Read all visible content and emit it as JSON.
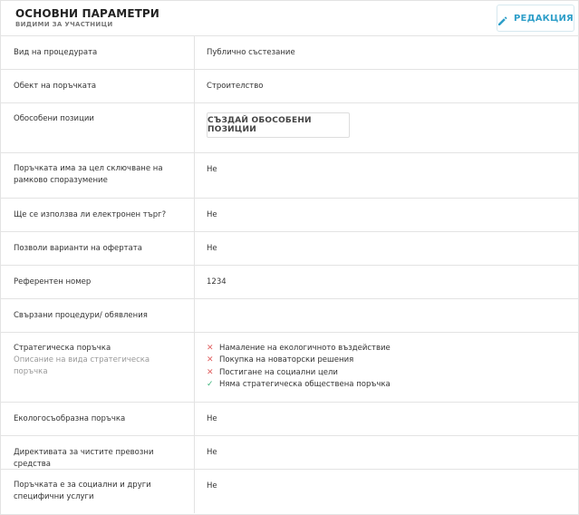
{
  "header": {
    "title": "ОСНОВНИ ПАРАМЕТРИ",
    "subtitle": "ВИДИМИ ЗА УЧАСТНИЦИ",
    "edit_label": "РЕДАКЦИЯ"
  },
  "rows": {
    "procedure_type": {
      "label": "Вид на процедурата",
      "value": "Публично състезание"
    },
    "order_object": {
      "label": "Обект на поръчката",
      "value": "Строителство"
    },
    "separate_positions": {
      "label": "Обособени позиции",
      "button": "СЪЗДАЙ ОБОСОБЕНИ ПОЗИЦИИ"
    },
    "framework": {
      "label": "Поръчката има за цел сключване на рамково споразумение",
      "value": "Не"
    },
    "e_auction": {
      "label": "Ще се използва ли електронен търг?",
      "value": "Не"
    },
    "variants": {
      "label": "Позволи варианти на офертата",
      "value": "Не"
    },
    "reference": {
      "label": "Референтен номер",
      "value": "1234"
    },
    "related": {
      "label": "Свързани процедури/ обявления",
      "value": ""
    },
    "strategic": {
      "label": "Стратегическа поръчка",
      "sublabel": "Описание на вида стратегическа поръчка",
      "items": [
        {
          "text": "Намаление на екологичното въздействие",
          "icon": "cross-icon"
        },
        {
          "text": "Покупка на новаторски решения",
          "icon": "cross-icon"
        },
        {
          "text": "Постигане на социални цели",
          "icon": "cross-icon"
        },
        {
          "text": "Няма стратегическа обществена поръчка",
          "icon": "check-icon"
        }
      ]
    },
    "eco": {
      "label": "Екологосъобразна поръчка",
      "value": "Не"
    },
    "clean_vehicles": {
      "label": "Директивата за чистите превозни средства",
      "value": "Не"
    },
    "social_services": {
      "label": "Поръчката е за социални и други специфични услуги",
      "value": "Не"
    }
  },
  "colors": {
    "accent": "#2f9fc9",
    "cross": "#e06060",
    "check": "#3bb37a",
    "border": "#e3e3e3"
  }
}
